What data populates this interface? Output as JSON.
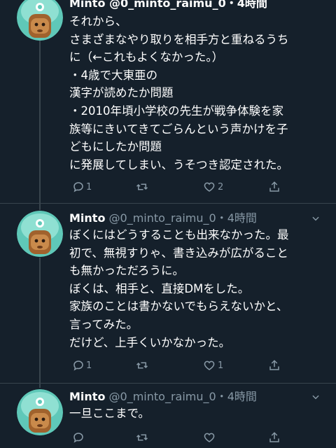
{
  "tweets": [
    {
      "name": "",
      "handle": "",
      "time": "",
      "header_partial": "Minto @0_minto_raimu_0・4時間",
      "lines": [
        "それから、",
        "さまざまなやり取りを相手方と重ねるうち",
        "に（←これもよくなかった。）",
        "・4歳で大東亜の",
        "漢字が読めたか問題",
        "・2010年頃小学校の先生が戦争体験を家",
        "族等にきいてきてごらんという声かけを子",
        "どもにしたか問題",
        "に発展してしまい、うそつき認定された。"
      ],
      "replies": "1",
      "retweets": "",
      "likes": "2"
    },
    {
      "name": "Minto",
      "handle": "@0_minto_raimu_0",
      "time": "・4時間",
      "lines": [
        "ぼくにはどうすることも出来なかった。最",
        "初で、無視すりゃ、書き込みが広がること",
        "も無かっただろうに。",
        "ぼくは、相手と、直接DMをした。",
        "家族のことは書かないでもらえないかと、",
        "言ってみた。",
        "だけど、上手くいかなかった。"
      ],
      "replies": "1",
      "retweets": "",
      "likes": "1"
    },
    {
      "name": "Minto",
      "handle": "@0_minto_raimu_0",
      "time": "・4時間",
      "lines": [
        "一旦ここまで。"
      ],
      "replies": "",
      "retweets": "",
      "likes": ""
    }
  ],
  "colors": {
    "background": "#15202b",
    "secondary_text": "#8899a6",
    "divider": "#38444d",
    "avatar_ring": "#6ed3c4"
  },
  "icons": [
    "reply-icon",
    "retweet-icon",
    "like-icon",
    "share-icon",
    "chevron-down-icon"
  ]
}
